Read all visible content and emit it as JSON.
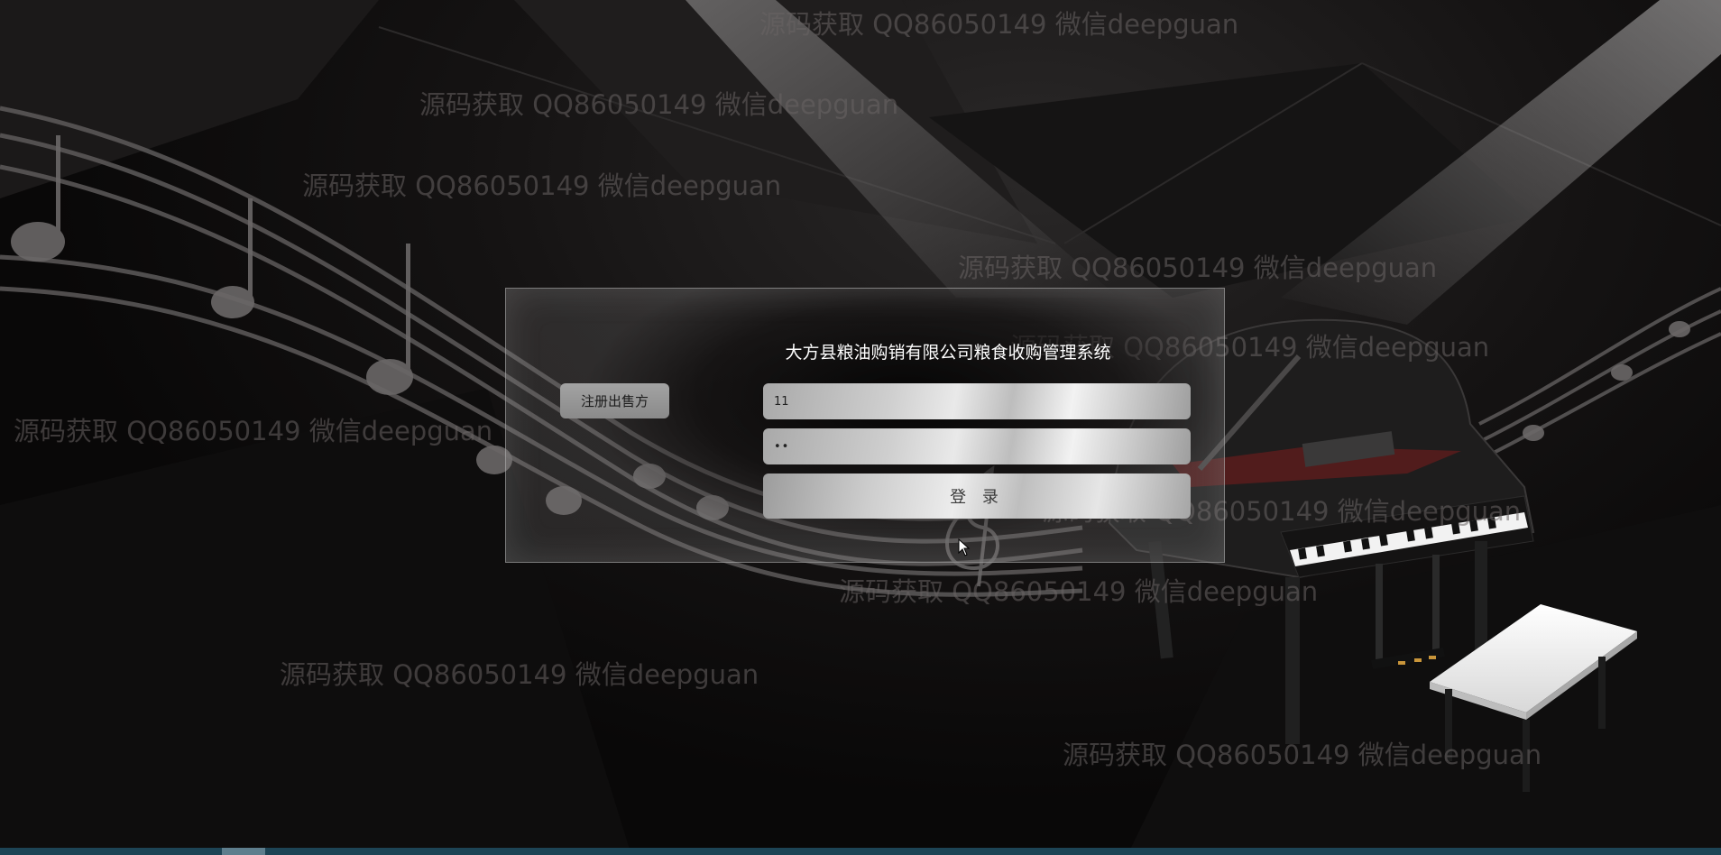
{
  "login": {
    "title": "大方县粮油购销有限公司粮食收购管理系统",
    "register_label": "注册出售方",
    "username_value": "11",
    "password_value": "••",
    "login_label": "登 录"
  },
  "watermarks": [
    "源码获取 QQ86050149 微信deepguan",
    "源码获取 QQ86050149 微信deepguan",
    "源码获取 QQ86050149 微信deepguan",
    "源码获取 QQ86050149 微信deepguan",
    "源码获取 QQ86050149 微信deepguan",
    "源码获取 QQ86050149 微信deepguan",
    "源码获取 QQ86050149 微信deepguan",
    "源码获取 QQ86050149 微信deepguan",
    "源码获取 QQ86050149 微信deepguan",
    "源码获取 QQ86050149 微信deepguan"
  ],
  "colors": {
    "background": "#0b0a0a",
    "panel_border": "#bebebe",
    "title_text": "#ffffff",
    "taskbar": "#1d4455"
  },
  "icons": {
    "cursor": "arrow-cursor-icon",
    "piano": "grand-piano-illustration",
    "notes": "music-staff-illustration"
  }
}
